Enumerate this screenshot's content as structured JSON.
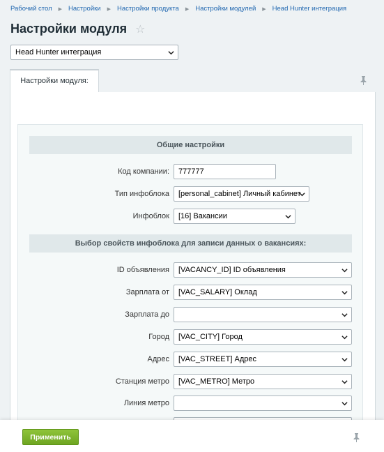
{
  "breadcrumb": [
    "Рабочий стол",
    "Настройки",
    "Настройки продукта",
    "Настройки модулей",
    "Head Hunter интеграция"
  ],
  "title": "Настройки модуля",
  "module_select": "Head Hunter интеграция",
  "tab_label": "Настройки модуля:",
  "general": {
    "heading": "Общие настройки",
    "company_code_label": "Код компании:",
    "company_code_value": "777777",
    "iblock_type_label": "Тип инфоблока",
    "iblock_type_value": "[personal_cabinet] Личный кабинет",
    "iblock_label": "Инфоблок",
    "iblock_value": "[16] Вакансии"
  },
  "properties": {
    "heading": "Выбор свойств инфоблока для записи данных о вакансиях:",
    "fields": [
      {
        "label": "ID объявления",
        "value": "[VACANCY_ID] ID объявления"
      },
      {
        "label": "Зарплата от",
        "value": "[VAC_SALARY] Оклад"
      },
      {
        "label": "Зарплата до",
        "value": ""
      },
      {
        "label": "Город",
        "value": "[VAC_CITY] Город"
      },
      {
        "label": "Адрес",
        "value": "[VAC_STREET] Адрес"
      },
      {
        "label": "Станция метро",
        "value": "[VAC_METRO] Метро"
      },
      {
        "label": "Линия метро",
        "value": ""
      }
    ]
  },
  "apply_button": "Применить"
}
